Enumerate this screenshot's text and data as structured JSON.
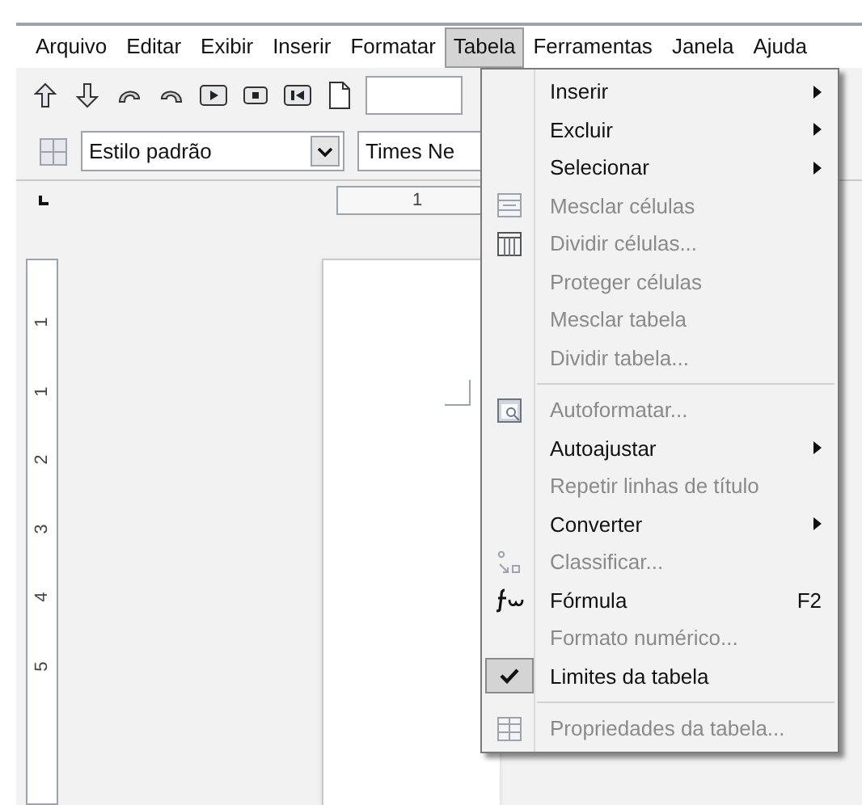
{
  "menu_bar": [
    {
      "label": "Arquivo",
      "selected": false
    },
    {
      "label": "Editar",
      "selected": false
    },
    {
      "label": "Exibir",
      "selected": false
    },
    {
      "label": "Inserir",
      "selected": false
    },
    {
      "label": "Formatar",
      "selected": false
    },
    {
      "label": "Tabela",
      "selected": true
    },
    {
      "label": "Ferramentas",
      "selected": false
    },
    {
      "label": "Janela",
      "selected": false
    },
    {
      "label": "Ajuda",
      "selected": false
    }
  ],
  "toolbar_2": {
    "paragraph_style": "Estilo padrão",
    "font_name": "Times Ne"
  },
  "horizontal_ruler": {
    "label": "1"
  },
  "vertical_ruler": [
    "1",
    "1",
    "2",
    "3",
    "4",
    "5"
  ],
  "tabela_menu": [
    {
      "kind": "submenu",
      "label": "Inserir",
      "disabled": false
    },
    {
      "kind": "submenu",
      "label": "Excluir",
      "disabled": false
    },
    {
      "kind": "submenu",
      "label": "Selecionar",
      "disabled": false
    },
    {
      "kind": "item",
      "label": "Mesclar células",
      "disabled": true
    },
    {
      "kind": "item",
      "label": "Dividir células...",
      "disabled": true
    },
    {
      "kind": "item",
      "label": "Proteger células",
      "disabled": true
    },
    {
      "kind": "item",
      "label": "Mesclar tabela",
      "disabled": true
    },
    {
      "kind": "item",
      "label": "Dividir tabela...",
      "disabled": true
    },
    {
      "kind": "separator"
    },
    {
      "kind": "item",
      "label": "Autoformatar...",
      "disabled": true
    },
    {
      "kind": "submenu",
      "label": "Autoajustar",
      "disabled": false
    },
    {
      "kind": "item",
      "label": "Repetir linhas de título",
      "disabled": true
    },
    {
      "kind": "submenu",
      "label": "Converter",
      "disabled": false
    },
    {
      "kind": "item",
      "label": "Classificar...",
      "disabled": true
    },
    {
      "kind": "item",
      "label": "Fórmula",
      "disabled": false,
      "shortcut": "F2"
    },
    {
      "kind": "item",
      "label": "Formato numérico...",
      "disabled": true
    },
    {
      "kind": "check",
      "label": "Limites da tabela",
      "disabled": false,
      "checked": true
    },
    {
      "kind": "separator"
    },
    {
      "kind": "item",
      "label": "Propriedades da tabela...",
      "disabled": true
    }
  ]
}
